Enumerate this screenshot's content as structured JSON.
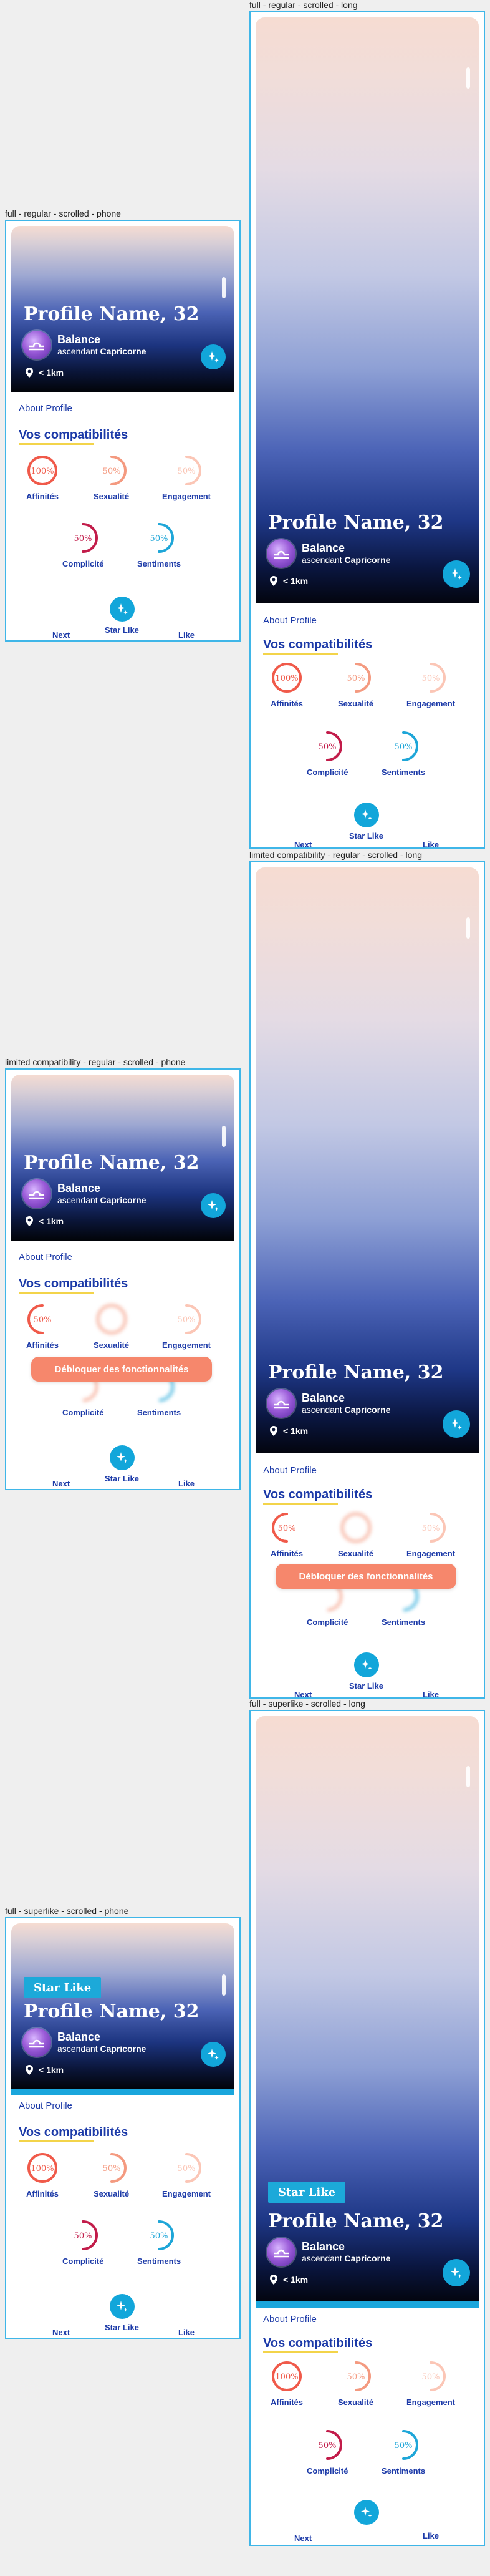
{
  "frames": {
    "phone_regular": {
      "label": "full - regular - scrolled - phone"
    },
    "long_regular": {
      "label": "full - regular - scrolled - long"
    },
    "phone_limited": {
      "label": "limited compatibility - regular - scrolled - phone"
    },
    "long_limited": {
      "label": "limited compatibility - regular - scrolled - long"
    },
    "phone_superlike": {
      "label": "full - superlike - scrolled - phone"
    },
    "long_superlike": {
      "label": "full - superlike - scrolled - long"
    }
  },
  "profile": {
    "name": "Profile Name, 32",
    "sign": "Balance",
    "ascendant_prefix": "ascendant",
    "ascendant": "Capricorne",
    "distance": "< 1km",
    "starlike_badge": "Star Like"
  },
  "sections": {
    "about": "About Profile",
    "compat_title": "Vos compatibilités"
  },
  "gauges": {
    "affinites": {
      "label": "Affinités",
      "value": "100%",
      "percent": 100
    },
    "sexualite": {
      "label": "Sexualité",
      "value": "50%",
      "percent": 50
    },
    "engagement": {
      "label": "Engagement",
      "value": "50%",
      "percent": 50
    },
    "complicite": {
      "label": "Complicité",
      "value": "50%",
      "percent": 50
    },
    "sentiments": {
      "label": "Sentiments",
      "value": "50%",
      "percent": 50
    }
  },
  "actions": {
    "next": "Next",
    "starlike": "Star Like",
    "like": "Like",
    "unlock": "Débloquer des fonctionnalités"
  },
  "colors": {
    "affinites": "#f05a4a",
    "sexualite": "#f49a80",
    "engagement": "#fbc6b6",
    "complicite": "#c21c4a",
    "sentiments": "#1ea6d8",
    "accent": "#12a6da",
    "text_blue": "#1c3aa8"
  }
}
